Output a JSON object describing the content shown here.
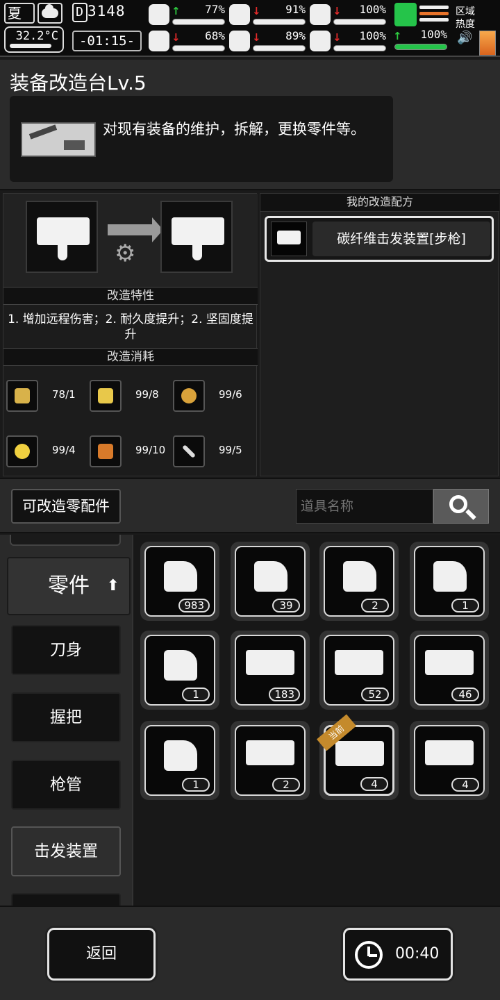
{
  "status": {
    "season": "夏",
    "temperature": "32.2°C",
    "day_digit": "D",
    "day_value": "3148",
    "clock": "-01:15-",
    "stats": [
      {
        "icon": "medkit-icon",
        "trend": "up",
        "value": "77%"
      },
      {
        "icon": "stomach-icon",
        "trend": "down",
        "value": "91%"
      },
      {
        "icon": "bladder-icon",
        "trend": "down",
        "value": "100%"
      },
      {
        "icon": "brain-icon",
        "trend": "down",
        "value": "68%"
      },
      {
        "icon": "water-drop-icon",
        "trend": "down",
        "value": "89%"
      },
      {
        "icon": "heart-icon",
        "trend": "down",
        "value": "100%"
      }
    ],
    "stamina": {
      "icon": "boot-icon",
      "trend": "up",
      "value": "100%"
    },
    "region_label_1": "区域",
    "region_label_2": "热度",
    "colors": {
      "up": "#2ecc40",
      "down": "#e52a2a",
      "stamina": "#25c44a"
    }
  },
  "header": {
    "title": "装备改造台Lv.5",
    "description": "对现有装备的维护，拆解，更换零件等。"
  },
  "modify": {
    "features_title": "改造特性",
    "features_text": "1. 增加远程伤害；2. 耐久度提升；2. 坚固度提升",
    "cost_title": "改造消耗",
    "costs": [
      {
        "icon": "wire-cutter-icon",
        "value": "78/1"
      },
      {
        "icon": "gold-plate-icon",
        "value": "99/8"
      },
      {
        "icon": "spool-icon",
        "value": "99/6"
      },
      {
        "icon": "flask-icon",
        "value": "99/4"
      },
      {
        "icon": "oil-bottle-icon",
        "value": "99/10"
      },
      {
        "icon": "syringe-tool-icon",
        "value": "99/5"
      }
    ]
  },
  "recipes": {
    "title": "我的改造配方",
    "items": [
      {
        "label": "碳纤维击发装置[步枪]"
      }
    ]
  },
  "toolbar": {
    "parts_button": "可改造零配件",
    "search_placeholder": "道具名称"
  },
  "categories": {
    "active": "零件",
    "items": [
      "刀身",
      "握把",
      "枪管",
      "击发装置"
    ]
  },
  "grid": {
    "current_tag": "当前",
    "items": [
      {
        "count": "983"
      },
      {
        "count": "39"
      },
      {
        "count": "2"
      },
      {
        "count": "1"
      },
      {
        "count": "1"
      },
      {
        "count": "183"
      },
      {
        "count": "52"
      },
      {
        "count": "46"
      },
      {
        "count": "1"
      },
      {
        "count": "2"
      },
      {
        "count": "4"
      },
      {
        "count": "4"
      }
    ]
  },
  "footer": {
    "back_label": "返回",
    "timer": "00:40"
  }
}
